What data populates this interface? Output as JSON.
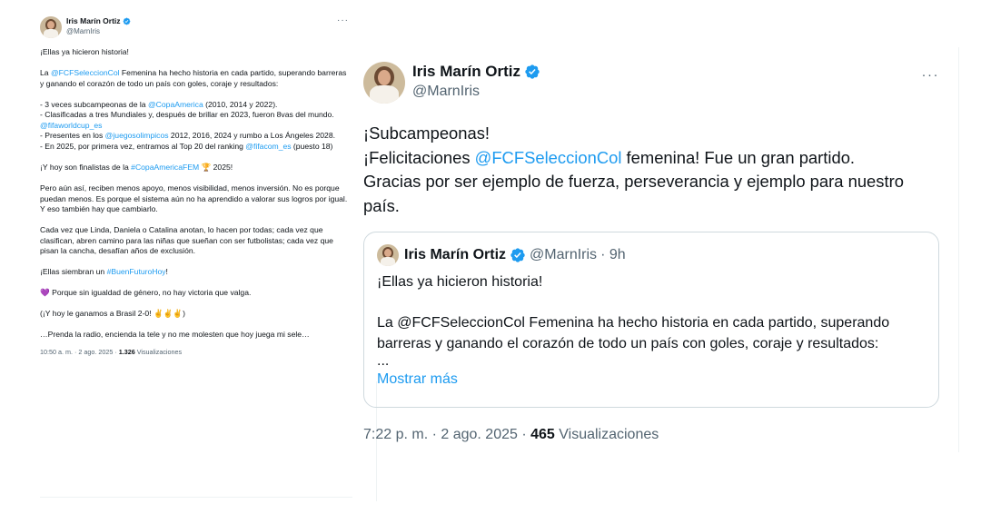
{
  "left_tweet": {
    "author": {
      "name": "Iris Marín Ortiz",
      "handle": "@MarnIris"
    },
    "more_icon": "more-horizontal-icon",
    "paragraphs": [
      [
        {
          "t": "¡Ellas ya hicieron historia!"
        }
      ],
      [
        {
          "t": "La "
        },
        {
          "t": "@FCFSeleccionCol",
          "link": true
        },
        {
          "t": " Femenina ha hecho historia en cada partido, superando barreras y ganando el corazón de todo un país con goles, coraje y resultados:"
        }
      ],
      [
        {
          "t": "- 3 veces subcampeonas de la "
        },
        {
          "t": "@CopaAmerica",
          "link": true
        },
        {
          "t": " (2010, 2014 y 2022).\n- Clasificadas a tres Mundiales y, después de brillar en 2023, fueron 8vas del mundo. "
        },
        {
          "t": "@fifaworldcup_es",
          "link": true
        },
        {
          "t": "\n- Presentes en los "
        },
        {
          "t": "@juegosolimpicos",
          "link": true
        },
        {
          "t": " 2012, 2016, 2024 y rumbo a Los Ángeles 2028.\n- En 2025, por primera vez, entramos al Top 20 del ranking "
        },
        {
          "t": "@fifacom_es",
          "link": true
        },
        {
          "t": " (puesto 18)"
        }
      ],
      [
        {
          "t": "¡Y hoy son finalistas de la "
        },
        {
          "t": "#CopaAmericaFEM",
          "link": true
        },
        {
          "t": " 🏆 2025!"
        }
      ],
      [
        {
          "t": "Pero aún así, reciben menos apoyo, menos visibilidad, menos inversión. No es porque puedan menos. Es porque el sistema aún no ha aprendido a valorar sus logros por igual. Y eso también hay que cambiarlo."
        }
      ],
      [
        {
          "t": "Cada vez que Linda, Daniela o Catalina anotan, lo hacen por todas; cada vez que clasifican, abren camino para las niñas que sueñan con ser futbolistas; cada vez que pisan la cancha, desafían años de exclusión."
        }
      ],
      [
        {
          "t": "¡Ellas siembran un "
        },
        {
          "t": "#BuenFuturoHoy",
          "link": true
        },
        {
          "t": "!"
        }
      ],
      [
        {
          "t": "💜 Porque sin igualdad de género, no hay victoria que valga."
        }
      ],
      [
        {
          "t": "(¡Y hoy le ganamos a Brasil 2-0! ✌️✌️✌️)"
        }
      ],
      [
        {
          "t": "…Prenda la radio, encienda la tele y  no me molesten que hoy juega mi sele…"
        }
      ]
    ],
    "footer": {
      "time": "10:50 a. m. · 2 ago. 2025 · ",
      "views": "1.326",
      "views_label": " Visualizaciones"
    }
  },
  "right_tweet": {
    "author": {
      "name": "Iris Marín Ortiz",
      "handle": "@MarnIris"
    },
    "more_icon": "more-horizontal-icon",
    "lines": [
      [
        {
          "t": "¡Subcampeonas!"
        }
      ],
      [
        {
          "t": "¡Felicitaciones "
        },
        {
          "t": "@FCFSeleccionCol",
          "link": true
        },
        {
          "t": " femenina! Fue un gran partido."
        }
      ],
      [
        {
          "t": "Gracias por ser ejemplo de fuerza, perseverancia y ejemplo para nuestro"
        }
      ],
      [
        {
          "t": "país."
        }
      ]
    ],
    "quote": {
      "name": "Iris Marín Ortiz",
      "handle": "@MarnIris",
      "age": "· 9h",
      "lines": [
        "¡Ellas ya hicieron historia!",
        "",
        "La @FCFSeleccionCol Femenina ha hecho historia en cada partido, superando",
        "barreras y ganando el corazón de todo un país con goles, coraje y resultados:",
        "..."
      ],
      "show_more": "Mostrar más"
    },
    "footer": {
      "time": "7:22 p. m. · 2 ago. 2025 · ",
      "views": "465",
      "views_label": " Visualizaciones"
    }
  },
  "colors": {
    "link": "#1d9bf0",
    "verified": "#1d9bf0",
    "text": "#0f1419",
    "muted": "#536471",
    "border": "#cfd9de"
  }
}
